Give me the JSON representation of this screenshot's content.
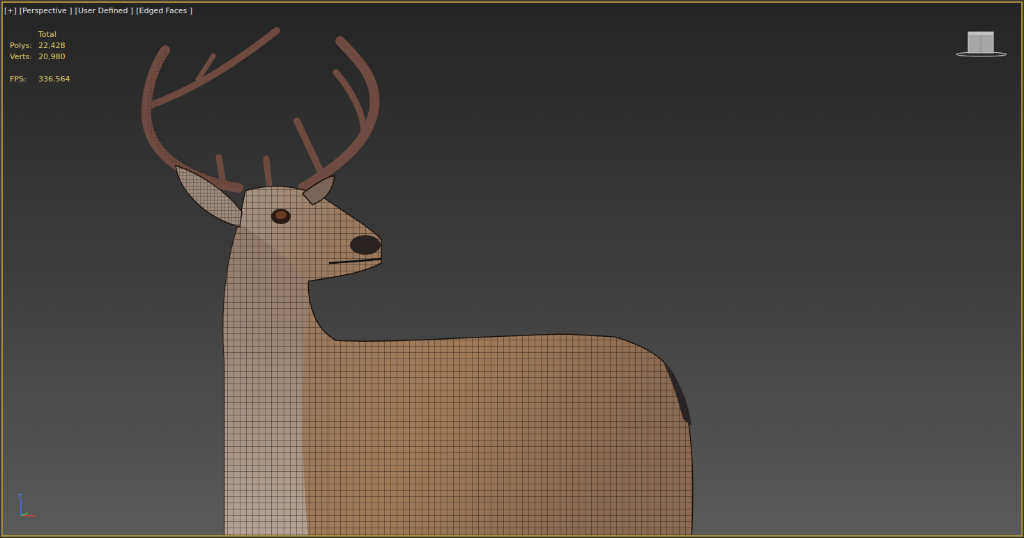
{
  "viewport": {
    "active": true,
    "labels": [
      {
        "text": "[+]"
      },
      {
        "text": "[Perspective ]"
      },
      {
        "text": "[User Defined ]"
      },
      {
        "text": "[Edged Faces ]"
      }
    ]
  },
  "stats": {
    "header": "Total",
    "rows": [
      {
        "label": "Polys:",
        "value": "22,428"
      },
      {
        "label": "Verts:",
        "value": "20,980"
      }
    ],
    "fps": {
      "label": "FPS:",
      "value": "336.564"
    }
  },
  "axis": {
    "label": "z"
  }
}
